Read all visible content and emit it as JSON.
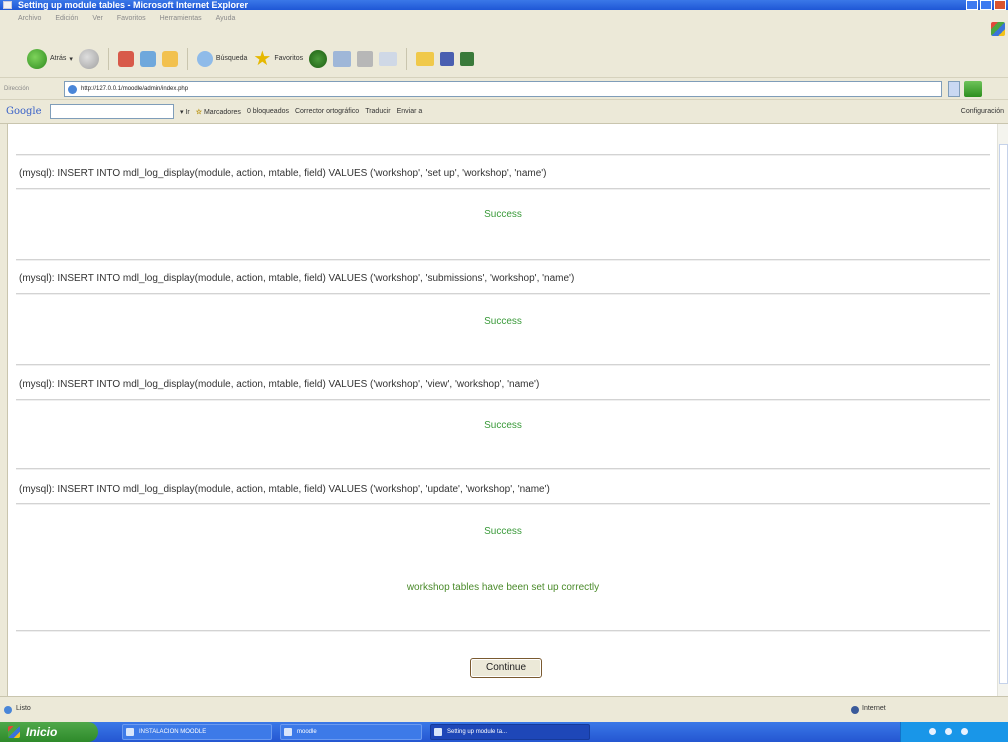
{
  "window": {
    "title": "Setting up module tables - Microsoft Internet Explorer"
  },
  "menubar": {
    "items": [
      "Archivo",
      "Edición",
      "Ver",
      "Favoritos",
      "Herramientas",
      "Ayuda"
    ]
  },
  "toolbar": {
    "back_label": "Atrás",
    "search_label": "Búsqueda",
    "favorites_label": "Favoritos"
  },
  "address": {
    "label": "Dirección",
    "url": "http://127.0.0.1/moodle/admin/index.php"
  },
  "googlebar": {
    "logo": "Google",
    "bookmarks_label": "Marcadores",
    "blocked_label": "0 bloqueados",
    "spell_label": "Corrector ortográfico",
    "translate_label": "Traducir",
    "send_label": "Enviar a",
    "config_label": "Configuración"
  },
  "content": {
    "queries": [
      "(mysql): INSERT INTO mdl_log_display(module, action, mtable, field) VALUES ('workshop', 'set up', 'workshop', 'name')",
      "(mysql): INSERT INTO mdl_log_display(module, action, mtable, field) VALUES ('workshop', 'submissions', 'workshop', 'name')",
      "(mysql): INSERT INTO mdl_log_display(module, action, mtable, field) VALUES ('workshop', 'view', 'workshop', 'name')",
      "(mysql): INSERT INTO mdl_log_display(module, action, mtable, field) VALUES ('workshop', 'update', 'workshop', 'name')"
    ],
    "success_label": "Success",
    "done_message": "workshop tables have been set up correctly",
    "continue_label": "Continue"
  },
  "statusbar": {
    "status_text": "Listo",
    "zone_text": "Internet"
  },
  "taskbar": {
    "start_label": "Inicio",
    "tasks": [
      "INSTALACION MOODLE",
      "moodle",
      "Setting up module ta..."
    ]
  },
  "colors": {
    "success_text": "#3a9a3a",
    "taskbar_blue": "#2456d1",
    "start_green": "#3e9a3a"
  }
}
